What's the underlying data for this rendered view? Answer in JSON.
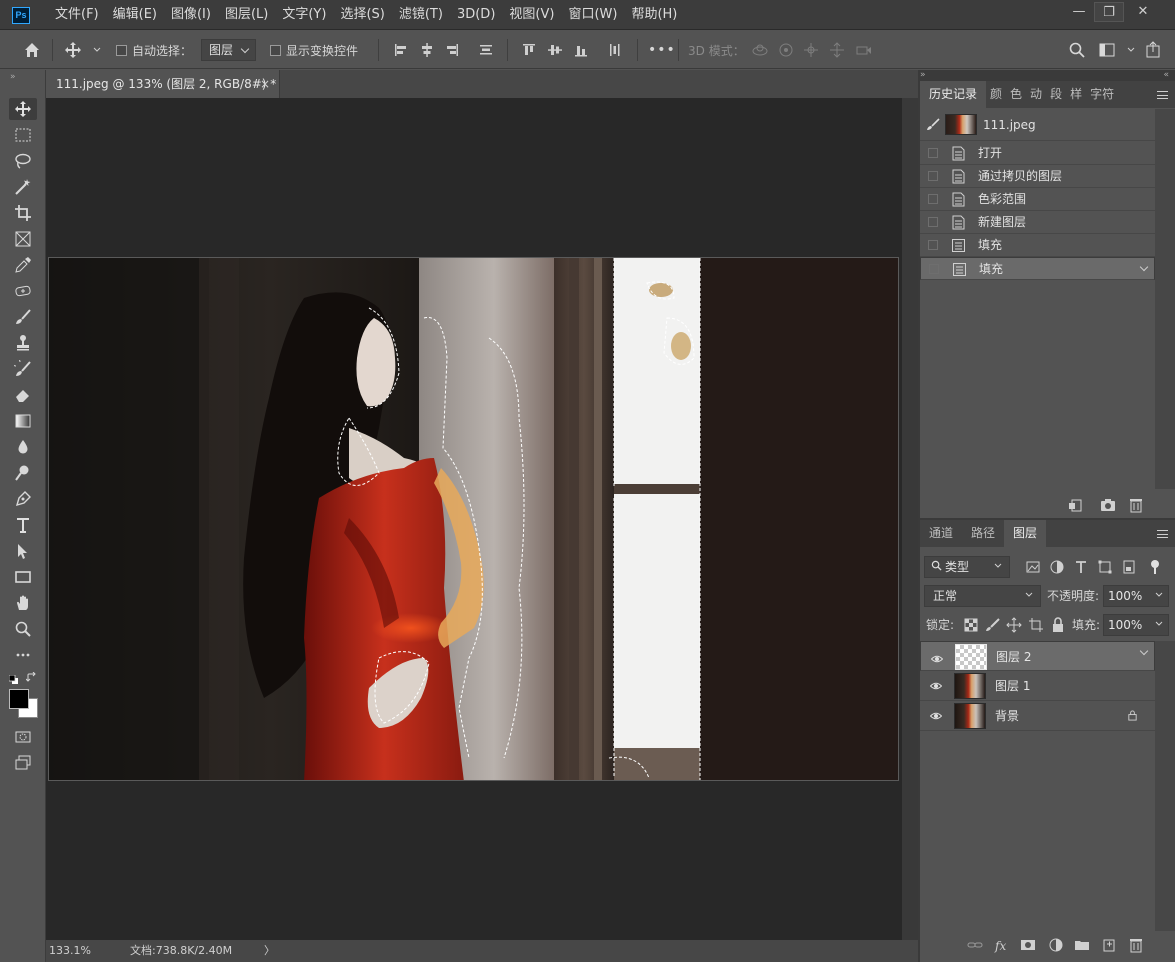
{
  "app": {
    "logo": "Ps"
  },
  "menu": [
    "文件(F)",
    "编辑(E)",
    "图像(I)",
    "图层(L)",
    "文字(Y)",
    "选择(S)",
    "滤镜(T)",
    "3D(D)",
    "视图(V)",
    "窗口(W)",
    "帮助(H)"
  ],
  "window_controls": {
    "minimize": "—",
    "restore": "❐",
    "close": "✕"
  },
  "options_bar": {
    "auto_select_label": "自动选择：",
    "auto_select_target": "图层",
    "show_transform_label": "显示变换控件",
    "more": "•••",
    "mode3d_label": "3D 模式："
  },
  "document": {
    "tab_title": "111.jpeg @ 133% (图层 2, RGB/8#) *",
    "close": "×",
    "zoom": "133.1%",
    "doc_info": "文档:738.8K/2.40M",
    "status_arrow": "〉"
  },
  "history_panel": {
    "tabs": [
      "历史记录",
      "颜",
      "色",
      "动",
      "段",
      "样",
      "字符"
    ],
    "snapshot_label": "111.jpeg",
    "items": [
      "打开",
      "通过拷贝的图层",
      "色彩范围",
      "新建图层",
      "填充",
      "填充"
    ],
    "selected_index": 5
  },
  "layers_panel": {
    "tabs": [
      "通道",
      "路径",
      "图层"
    ],
    "filter_label": "类型",
    "blend_mode": "正常",
    "opacity_label": "不透明度:",
    "opacity_value": "100%",
    "lock_label": "锁定:",
    "fill_label": "填充:",
    "fill_value": "100%",
    "layers": [
      {
        "name": "图层 2",
        "selected": true,
        "locked": false
      },
      {
        "name": "图层 1",
        "selected": false,
        "locked": false
      },
      {
        "name": "背景",
        "selected": false,
        "locked": true
      }
    ]
  },
  "colors": {
    "accent": "#31a8ff",
    "ui_bg": "#535353",
    "canvas_bg": "#282828",
    "dress": "#b3261a"
  }
}
